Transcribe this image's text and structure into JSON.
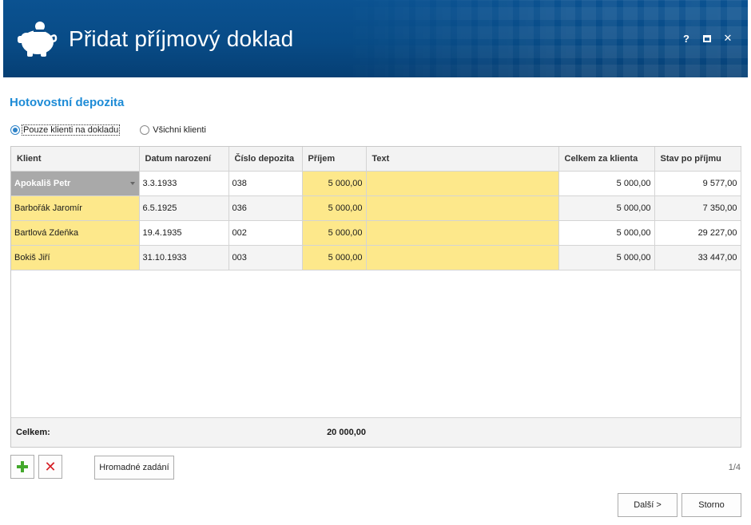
{
  "window": {
    "title": "Přidat příjmový doklad",
    "help_label": "?",
    "close_label": "✕"
  },
  "section_title": "Hotovostní depozita",
  "filter": {
    "options": [
      {
        "label": "Pouze klienti na dokladu",
        "checked": true
      },
      {
        "label": "Všichni klienti",
        "checked": false
      }
    ]
  },
  "table": {
    "columns": [
      "Klient",
      "Datum narození",
      "Číslo depozita",
      "Příjem",
      "Text",
      "Celkem za klienta",
      "Stav po příjmu"
    ],
    "rows": [
      {
        "klient": "Apokališ Petr",
        "datum": "3.3.1933",
        "cislo": "038",
        "prijem": "5 000,00",
        "text": "",
        "celkem": "5 000,00",
        "stav": "9 577,00"
      },
      {
        "klient": "Barbořák Jaromír",
        "datum": "6.5.1925",
        "cislo": "036",
        "prijem": "5 000,00",
        "text": "",
        "celkem": "5 000,00",
        "stav": "7 350,00"
      },
      {
        "klient": "Bartlová Zdeňka",
        "datum": "19.4.1935",
        "cislo": "002",
        "prijem": "5 000,00",
        "text": "",
        "celkem": "5 000,00",
        "stav": "29 227,00"
      },
      {
        "klient": "Bokiš Jiří",
        "datum": "31.10.1933",
        "cislo": "003",
        "prijem": "5 000,00",
        "text": "",
        "celkem": "5 000,00",
        "stav": "33 447,00"
      }
    ],
    "footer": {
      "label": "Celkem:",
      "total": "20 000,00"
    }
  },
  "toolbar": {
    "add_icon": "plus-icon",
    "delete_icon": "x-icon",
    "delete_label": "✕",
    "bulk_label": "Hromadné zadání",
    "page_indicator": "1/4"
  },
  "actions": {
    "next_label": "Další >",
    "cancel_label": "Storno"
  },
  "colors": {
    "header_bg": "#0b5291",
    "section_title": "#1d8bd6",
    "editable_cell": "#fde88b",
    "selected_cell": "#a9a9a9"
  }
}
